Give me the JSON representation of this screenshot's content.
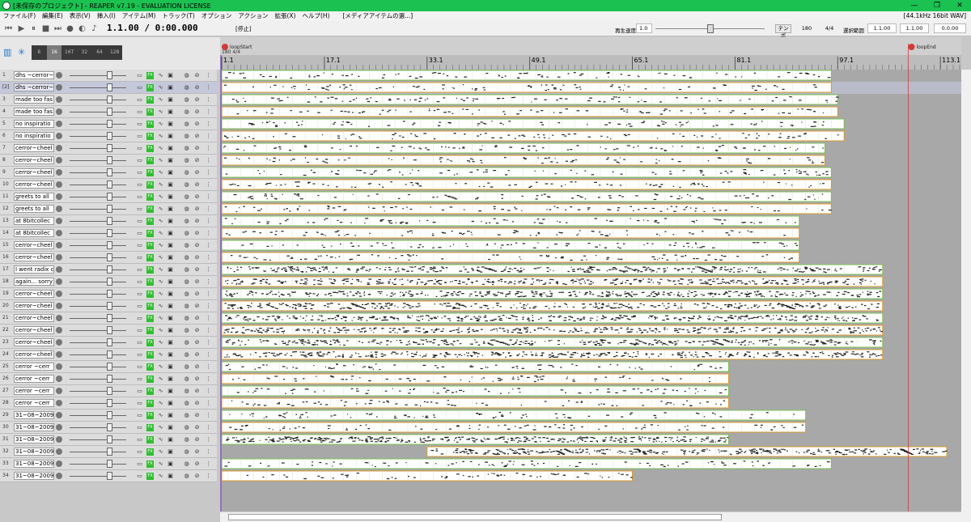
{
  "window": {
    "title": "[未保存のプロジェクト] - REAPER v7.19 - EVALUATION LICENSE",
    "minimize": "—",
    "maximize": "❐",
    "close": "✕"
  },
  "menu": {
    "items": [
      "ファイル(F)",
      "編集(E)",
      "表示(V)",
      "挿入(I)",
      "アイテム(M)",
      "トラック(T)",
      "オプション",
      "アクション",
      "拡張(X)",
      "ヘルプ(H)"
    ],
    "media_explorer": "[メディアアイテムの選...]",
    "audio_info": "[44.1kHz 16bit WAV]"
  },
  "transport": {
    "timecode": "1.1.00 / 0:00.000",
    "status": "[停止]",
    "rate_label": "再生速度",
    "rate_value": "1.0",
    "rate_fraction": 0.5,
    "tempo_label": "テンポ",
    "tempo": "180",
    "time_signature": "4/4",
    "selection_label": "選択範囲",
    "selection_start": "1.1.00",
    "selection_end": "1.1.00",
    "selection_length": "0.0.00"
  },
  "grid": {
    "options": [
      "8",
      "16",
      "16T",
      "32",
      "64",
      "128"
    ],
    "selected": "16"
  },
  "markers": {
    "loop_start": "loopStart",
    "loop_end": "loopEnd",
    "tempo_marker": "180 4/4"
  },
  "ruler": {
    "labels": [
      "1.1",
      "17.1",
      "33.1",
      "49.1",
      "65.1",
      "81.1",
      "97.1",
      "113.1"
    ]
  },
  "tracks": [
    {
      "num": "1",
      "name": "dhs ~cerror~"
    },
    {
      "num": "[2]",
      "name": "dhs ~cerror~",
      "selected": true
    },
    {
      "num": "3",
      "name": "made too fas"
    },
    {
      "num": "4",
      "name": "made too fas"
    },
    {
      "num": "5",
      "name": "no inspiratio"
    },
    {
      "num": "6",
      "name": "no inspiratio"
    },
    {
      "num": "7",
      "name": "cerror~cheel"
    },
    {
      "num": "8",
      "name": "cerror~cheel"
    },
    {
      "num": "9",
      "name": "cerror~cheel"
    },
    {
      "num": "10",
      "name": "cerror~cheel"
    },
    {
      "num": "11",
      "name": "greets to all"
    },
    {
      "num": "12",
      "name": "greets to all"
    },
    {
      "num": "13",
      "name": "at 8bitcollec"
    },
    {
      "num": "14",
      "name": "at 8bitcollec"
    },
    {
      "num": "15",
      "name": "cerror~cheel"
    },
    {
      "num": "16",
      "name": "cerror~cheel"
    },
    {
      "num": "17",
      "name": "I went radix c"
    },
    {
      "num": "18",
      "name": "again... sorry"
    },
    {
      "num": "19",
      "name": "cerror~cheel"
    },
    {
      "num": "20",
      "name": "cerror~cheel"
    },
    {
      "num": "21",
      "name": "cerror~cheel"
    },
    {
      "num": "22",
      "name": "cerror~cheel"
    },
    {
      "num": "23",
      "name": "cerror~cheel"
    },
    {
      "num": "24",
      "name": "cerror~cheel"
    },
    {
      "num": "25",
      "name": "cerror ~cerr"
    },
    {
      "num": "26",
      "name": "cerror ~cerr"
    },
    {
      "num": "27",
      "name": "cerror ~cerr"
    },
    {
      "num": "28",
      "name": "cerror ~cerr"
    },
    {
      "num": "29",
      "name": "31~08~2009"
    },
    {
      "num": "30",
      "name": "31~08~2009"
    },
    {
      "num": "31",
      "name": "31~08~2009"
    },
    {
      "num": "32",
      "name": "31~08~2009"
    },
    {
      "num": "33",
      "name": "31~08~2009"
    },
    {
      "num": "34",
      "name": "31~08~2009"
    }
  ],
  "items": [
    {
      "t": 0,
      "s": 1,
      "e": 96
    },
    {
      "t": 1,
      "s": 1,
      "e": 96
    },
    {
      "t": 2,
      "s": 1,
      "e": 97
    },
    {
      "t": 3,
      "s": 1,
      "e": 97
    },
    {
      "t": 4,
      "s": 1,
      "e": 98
    },
    {
      "t": 5,
      "s": 1,
      "e": 98
    },
    {
      "t": 6,
      "s": 1,
      "e": 95
    },
    {
      "t": 7,
      "s": 1,
      "e": 95
    },
    {
      "t": 8,
      "s": 1,
      "e": 96
    },
    {
      "t": 9,
      "s": 1,
      "e": 96
    },
    {
      "t": 10,
      "s": 1,
      "e": 96
    },
    {
      "t": 11,
      "s": 1,
      "e": 96
    },
    {
      "t": 12,
      "s": 1,
      "e": 91
    },
    {
      "t": 13,
      "s": 1,
      "e": 91
    },
    {
      "t": 14,
      "s": 1,
      "e": 91
    },
    {
      "t": 15,
      "s": 1,
      "e": 91
    },
    {
      "t": 16,
      "s": 1,
      "e": 104
    },
    {
      "t": 17,
      "s": 1,
      "e": 104
    },
    {
      "t": 18,
      "s": 1,
      "e": 104
    },
    {
      "t": 19,
      "s": 1,
      "e": 104
    },
    {
      "t": 20,
      "s": 1,
      "e": 104
    },
    {
      "t": 21,
      "s": 1,
      "e": 104
    },
    {
      "t": 22,
      "s": 1,
      "e": 104
    },
    {
      "t": 23,
      "s": 1,
      "e": 104
    },
    {
      "t": 24,
      "s": 1,
      "e": 80
    },
    {
      "t": 25,
      "s": 1,
      "e": 80
    },
    {
      "t": 26,
      "s": 1,
      "e": 80
    },
    {
      "t": 27,
      "s": 1,
      "e": 80
    },
    {
      "t": 28,
      "s": 1,
      "e": 92
    },
    {
      "t": 29,
      "s": 1,
      "e": 92
    },
    {
      "t": 30,
      "s": 1,
      "e": 80
    },
    {
      "t": 31,
      "s": 33,
      "e": 114
    },
    {
      "t": 32,
      "s": 1,
      "e": 96
    },
    {
      "t": 33,
      "s": 1,
      "e": 65
    }
  ],
  "colors": {
    "titlebar": "#1bc251",
    "item_bg": "#ffffff",
    "item_note": "#222222",
    "item_border_orange": "#d89a2c",
    "item_border_green": "#7cbf55",
    "marker_red": "#d23a3a",
    "edit_cursor": "#7a3ccc"
  }
}
